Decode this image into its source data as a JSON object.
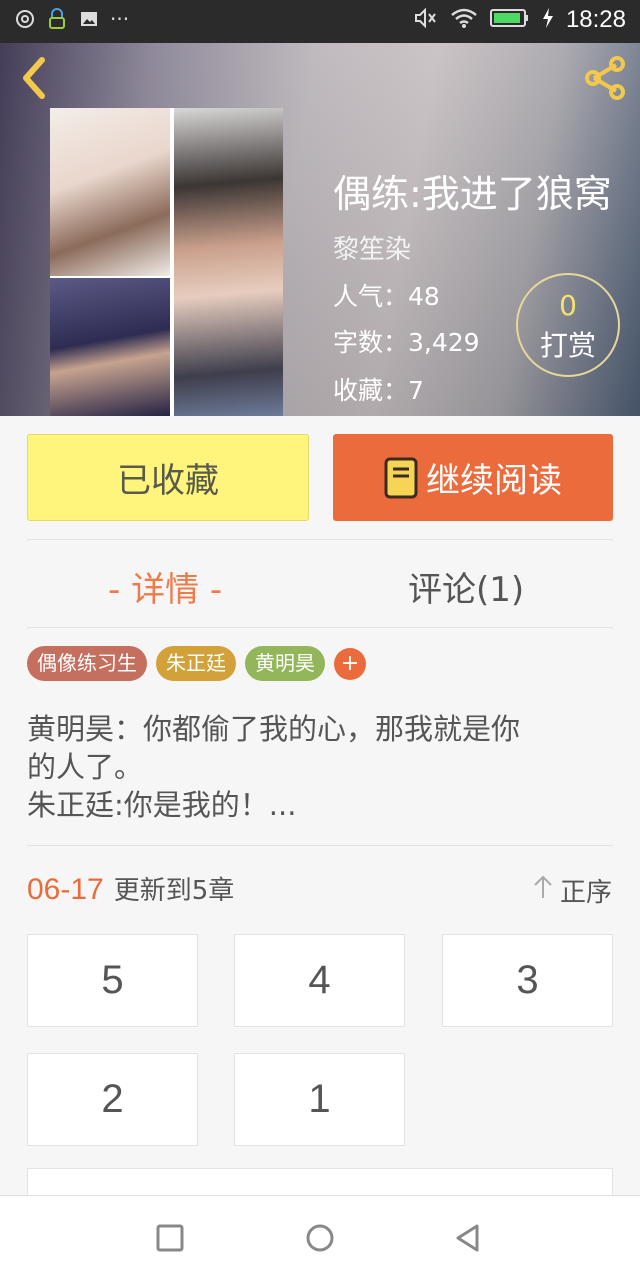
{
  "status_bar": {
    "time": "18:28",
    "overflow_dots": "···"
  },
  "book": {
    "title": "偶练:我进了狼窝",
    "author": "黎笙染",
    "stats": [
      {
        "label": "人气：",
        "value": "48"
      },
      {
        "label": "字数：",
        "value": "3,429"
      },
      {
        "label": "收藏：",
        "value": "7"
      }
    ],
    "tip": {
      "count": "0",
      "label": "打赏"
    }
  },
  "actions": {
    "favorited_label": "已收藏",
    "continue_label": "继续阅读"
  },
  "tabs": [
    {
      "label": "- 详情 -",
      "active": true
    },
    {
      "label": "评论(1)",
      "active": false
    }
  ],
  "tags": [
    "偶像练习生",
    "朱正廷",
    "黄明昊"
  ],
  "tag_add": "+",
  "description": [
    "黄明昊：你都偷了我的心，那我就是你",
    "的人了。",
    "朱正廷:你是我的！..."
  ],
  "update": {
    "date": "06-17",
    "text": "更新到5章",
    "sort_label": "正序"
  },
  "chapters": [
    "5",
    "4",
    "3",
    "2",
    "1"
  ],
  "colors": {
    "accent": "#ec6b3c",
    "favorite_button": "#fff57c",
    "tag1": "#c56f5f",
    "tag2": "#d2a139",
    "tag3": "#93b65a"
  }
}
